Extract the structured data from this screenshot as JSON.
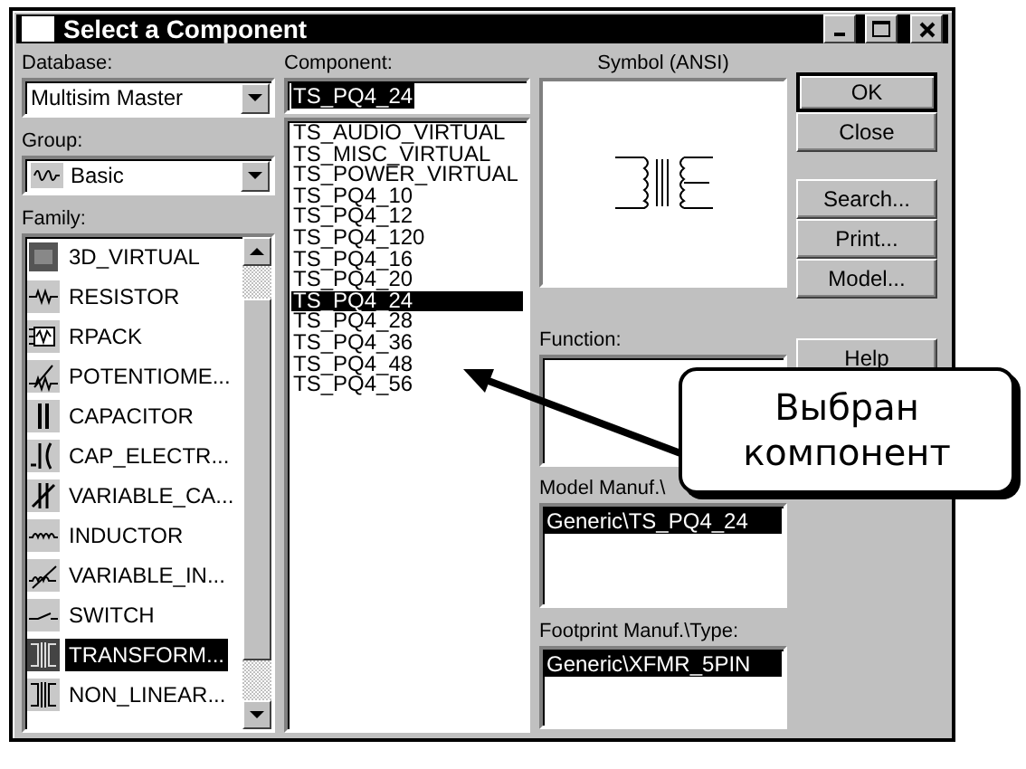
{
  "window": {
    "title": "Select a Component"
  },
  "database": {
    "label": "Database:",
    "value": "Multisim Master"
  },
  "group": {
    "label": "Group:",
    "value": "Basic"
  },
  "family": {
    "label": "Family:",
    "items": [
      {
        "kind": "cube",
        "label": "3D_VIRTUAL",
        "selected": false
      },
      {
        "kind": "resistor",
        "label": "RESISTOR",
        "selected": false
      },
      {
        "kind": "rpack",
        "label": "RPACK",
        "selected": false
      },
      {
        "kind": "potentiometer",
        "label": "POTENTIOME...",
        "selected": false
      },
      {
        "kind": "capacitor",
        "label": "CAPACITOR",
        "selected": false
      },
      {
        "kind": "cap_electrolytic",
        "label": "CAP_ELECTR...",
        "selected": false
      },
      {
        "kind": "variable_capacitor",
        "label": "VARIABLE_CA...",
        "selected": false
      },
      {
        "kind": "inductor",
        "label": "INDUCTOR",
        "selected": false
      },
      {
        "kind": "variable_inductor",
        "label": "VARIABLE_IN...",
        "selected": false
      },
      {
        "kind": "switch",
        "label": "SWITCH",
        "selected": false
      },
      {
        "kind": "transformer",
        "label": "TRANSFORM...",
        "selected": true
      },
      {
        "kind": "nonlinear_transformer",
        "label": "NON_LINEAR...",
        "selected": false
      }
    ]
  },
  "component": {
    "label": "Component:",
    "value": "TS_PQ4_24",
    "items": [
      {
        "label": "TS_AUDIO_VIRTUAL",
        "selected": false
      },
      {
        "label": "TS_MISC_VIRTUAL",
        "selected": false
      },
      {
        "label": "TS_POWER_VIRTUAL",
        "selected": false
      },
      {
        "label": "TS_PQ4_10",
        "selected": false
      },
      {
        "label": "TS_PQ4_12",
        "selected": false
      },
      {
        "label": "TS_PQ4_120",
        "selected": false
      },
      {
        "label": "TS_PQ4_16",
        "selected": false
      },
      {
        "label": "TS_PQ4_20",
        "selected": false
      },
      {
        "label": "TS_PQ4_24",
        "selected": true
      },
      {
        "label": "TS_PQ4_28",
        "selected": false
      },
      {
        "label": "TS_PQ4_36",
        "selected": false
      },
      {
        "label": "TS_PQ4_48",
        "selected": false
      },
      {
        "label": "TS_PQ4_56",
        "selected": false
      }
    ]
  },
  "symbol": {
    "label": "Symbol (ANSI)"
  },
  "function": {
    "label": "Function:"
  },
  "model": {
    "label": "Model Manuf.\\",
    "items": [
      {
        "label": "Generic\\TS_PQ4_24",
        "selected": true
      }
    ]
  },
  "footprint": {
    "label": "Footprint Manuf.\\Type:",
    "items": [
      {
        "label": "Generic\\XFMR_5PIN",
        "selected": true
      }
    ]
  },
  "buttons": [
    {
      "label": "OK",
      "default": true
    },
    {
      "label": "Close",
      "default": false
    },
    {
      "label": "Search...",
      "default": false
    },
    {
      "label": "Print...",
      "default": false
    },
    {
      "label": "Model...",
      "default": false
    },
    {
      "label": "Help"
    }
  ],
  "callout": {
    "text": "Выбран компонент"
  }
}
